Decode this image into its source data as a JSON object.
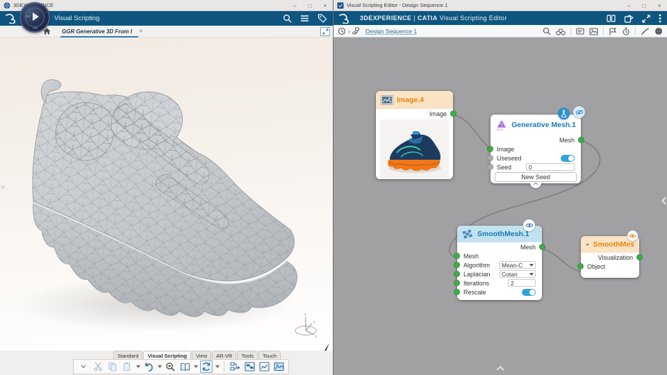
{
  "left_window": {
    "titlebar": {
      "title": "3DEXPERIENCE",
      "minimize": "–",
      "maximize": "□",
      "close": "×"
    },
    "brandbar": {
      "app_name": "Visual Scripting"
    },
    "compass": {
      "top_label": "3D",
      "bottom_label": "V.R"
    },
    "tabbar": {
      "active_tab": "GGR Generative 3D From I",
      "add_tab": "+"
    },
    "dock": {
      "tabs": [
        "Standard",
        "Visual Scripting",
        "View",
        "AR-VR",
        "Tools",
        "Touch"
      ],
      "active_tab": "Visual Scripting"
    }
  },
  "right_window": {
    "titlebar": {
      "title": "Visual Scripting Editor - Design Sequence.1",
      "minimize": "–",
      "maximize": "□",
      "close": "×"
    },
    "brandbar": {
      "brand": "3DEXPERIENCE",
      "divider": "|",
      "product": "CATIA",
      "app": "Visual Scripting Editor"
    },
    "toolbar": {
      "breadcrumb": "Design Sequence 1"
    },
    "graph": {
      "image_node": {
        "title": "Image.4",
        "output": "Image"
      },
      "generative_node": {
        "title": "Generative Mesh.1",
        "output": "Mesh",
        "input_image": "Image",
        "input_useseed": "Useseed",
        "input_seed": "Seed",
        "seed_value": "0",
        "new_seed_button": "New Seed"
      },
      "smooth_node": {
        "title": "SmoothMesh.1",
        "output": "Mesh",
        "input_mesh": "Mesh",
        "input_algorithm": "Algorithm",
        "algorithm_value": "Mean-C",
        "input_laplacian": "Laplacian",
        "laplacian_value": "Cotan",
        "input_iterations": "Iterations",
        "iterations_value": "2",
        "input_rescale": "Rescale"
      },
      "viz_node": {
        "title": "SmoothMes",
        "output": "Visualization",
        "input_object": "Object"
      }
    }
  },
  "colors": {
    "header_blue": "#0E567F",
    "canvas_gray": "#A1A1A3",
    "node_orange_header": "#FAE3C4",
    "node_orange_text": "#E8830C",
    "node_blue_header": "#C3E2F0",
    "node_blue_text": "#1878B4",
    "port_green": "#3FAE49",
    "port_gray": "#ABABAB",
    "toggle_blue": "#2FA3DB",
    "wire_gray": "#7F7F7F"
  }
}
